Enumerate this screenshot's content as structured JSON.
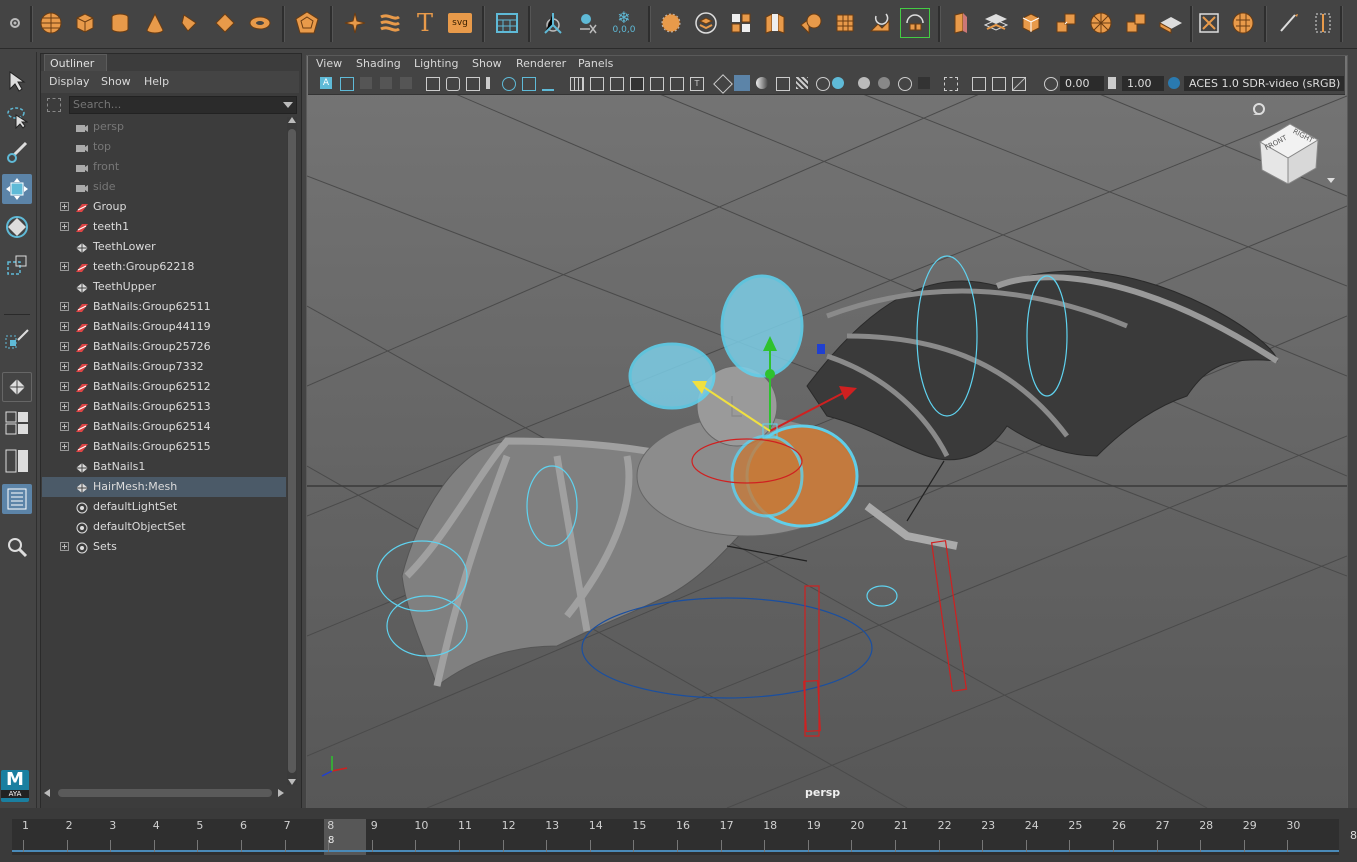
{
  "shelf": {
    "icons": [
      "settings-icon",
      "sphere-icon",
      "cube-icon",
      "cylinder-icon",
      "cone-icon",
      "torus-icon",
      "plane-icon",
      "disc-icon",
      "platonic-icon",
      "sweep-icon",
      "type-icon",
      "svg-icon",
      "grid-icon",
      "pivot-icon",
      "axes-icon",
      "snowflake-icon",
      "combine-icon",
      "separate-icon",
      "smooth-icon",
      "extrude-icon",
      "bridge-icon",
      "bevel-icon",
      "booleans-icon",
      "subdivide-icon",
      "transfer-icon",
      "mirror-icon",
      "retopo-icon",
      "uv-icon",
      "texture-icon",
      "lattice-icon",
      "quad-draw-icon",
      "sculpt-icon"
    ],
    "type_label": "T",
    "svg_label": "svg",
    "coord_label": "0,0,0"
  },
  "outliner": {
    "tab_label": "Outliner",
    "menu": [
      "Display",
      "Show",
      "Help"
    ],
    "search_placeholder": "Search...",
    "items": [
      {
        "label": "persp",
        "icon": "camera-icon",
        "expandable": false,
        "dim": true
      },
      {
        "label": "top",
        "icon": "camera-icon",
        "expandable": false,
        "dim": true
      },
      {
        "label": "front",
        "icon": "camera-icon",
        "expandable": false,
        "dim": true
      },
      {
        "label": "side",
        "icon": "camera-icon",
        "expandable": false,
        "dim": true
      },
      {
        "label": "Group",
        "icon": "transform-icon",
        "expandable": true
      },
      {
        "label": "teeth1",
        "icon": "transform-icon",
        "expandable": true
      },
      {
        "label": "TeethLower",
        "icon": "mesh-icon",
        "expandable": false
      },
      {
        "label": "teeth:Group62218",
        "icon": "transform-icon",
        "expandable": true
      },
      {
        "label": "TeethUpper",
        "icon": "mesh-icon",
        "expandable": false
      },
      {
        "label": "BatNails:Group62511",
        "icon": "transform-icon",
        "expandable": true
      },
      {
        "label": "BatNails:Group44119",
        "icon": "transform-icon",
        "expandable": true
      },
      {
        "label": "BatNails:Group25726",
        "icon": "transform-icon",
        "expandable": true
      },
      {
        "label": "BatNails:Group7332",
        "icon": "transform-icon",
        "expandable": true
      },
      {
        "label": "BatNails:Group62512",
        "icon": "transform-icon",
        "expandable": true
      },
      {
        "label": "BatNails:Group62513",
        "icon": "transform-icon",
        "expandable": true
      },
      {
        "label": "BatNails:Group62514",
        "icon": "transform-icon",
        "expandable": true
      },
      {
        "label": "BatNails:Group62515",
        "icon": "transform-icon",
        "expandable": true
      },
      {
        "label": "BatNails1",
        "icon": "mesh-icon",
        "expandable": false
      },
      {
        "label": "HairMesh:Mesh",
        "icon": "mesh-icon",
        "expandable": false,
        "selected": true
      },
      {
        "label": "defaultLightSet",
        "icon": "set-icon",
        "expandable": false
      },
      {
        "label": "defaultObjectSet",
        "icon": "set-icon",
        "expandable": false
      },
      {
        "label": "Sets",
        "icon": "set-icon",
        "expandable": true
      }
    ]
  },
  "viewport": {
    "menu": [
      "View",
      "Shading",
      "Lighting",
      "Show",
      "Renderer",
      "Panels"
    ],
    "exposure": "0.00",
    "gamma": "1.00",
    "color_space": "ACES 1.0 SDR-video (sRGB)",
    "camera_label": "persp",
    "view_cube": {
      "front": "FRONT",
      "right": "RIGHT"
    }
  },
  "timeline": {
    "frames": [
      "1",
      "2",
      "3",
      "4",
      "5",
      "6",
      "7",
      "8",
      "9",
      "10",
      "11",
      "12",
      "13",
      "14",
      "15",
      "16",
      "17",
      "18",
      "19",
      "20",
      "21",
      "22",
      "23",
      "24",
      "25",
      "26",
      "27",
      "28",
      "29",
      "30"
    ],
    "current_frame": "8",
    "end_partial": "8"
  },
  "maya_badge": {
    "letter": "M",
    "text": "AYA"
  },
  "colors": {
    "accent": "#5c84a8",
    "shelf_orange": "#e89a4a",
    "hair_cyan": "#5fd3f0",
    "rig_red": "#d02020"
  }
}
